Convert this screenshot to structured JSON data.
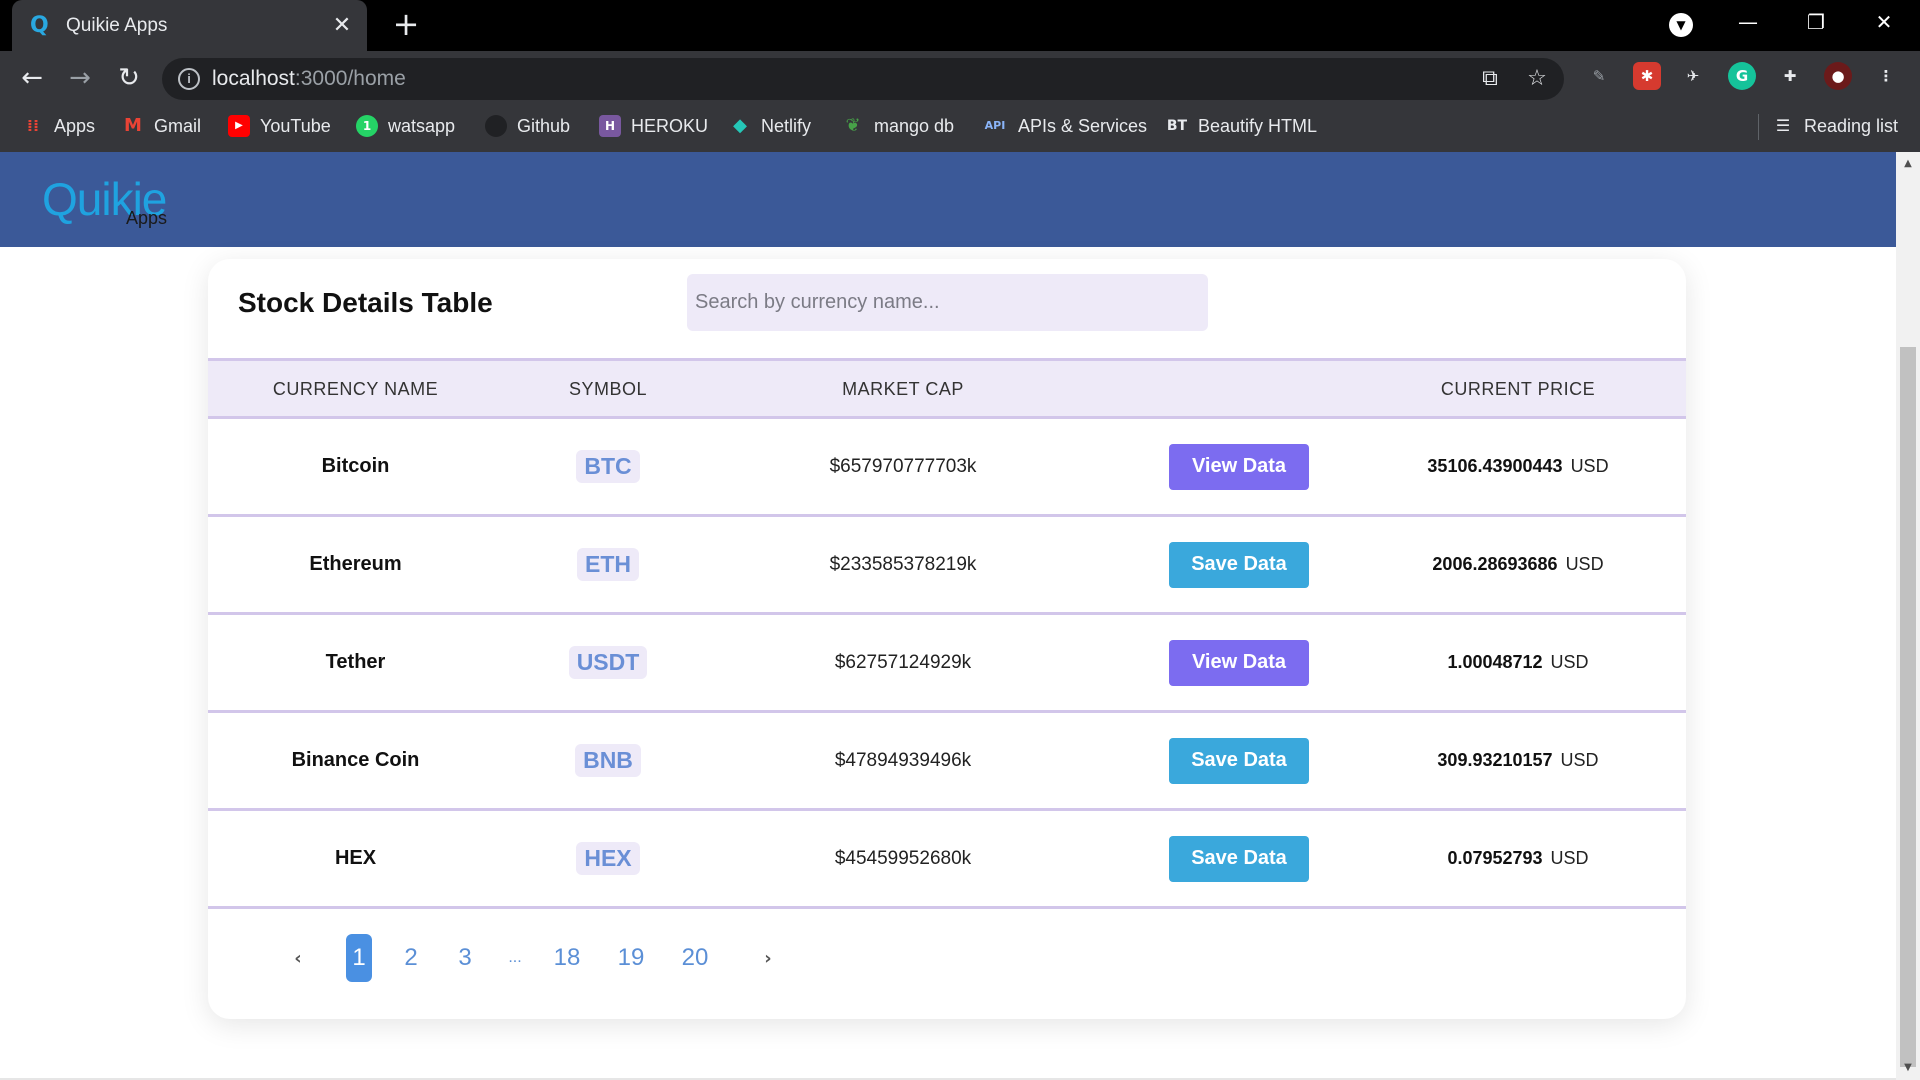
{
  "browser": {
    "tab_title": "Quikie Apps",
    "tab_close": "✕",
    "new_tab": "+",
    "url_host": "localhost",
    "url_rest": ":3000/home",
    "info_icon": "i",
    "window_controls": {
      "minimize": "—",
      "restore": "❐",
      "close": "✕"
    },
    "bookmarks": [
      {
        "label": "Apps",
        "icon": "apps-grid-icon"
      },
      {
        "label": "Gmail",
        "icon": "gmail-icon"
      },
      {
        "label": "YouTube",
        "icon": "youtube-icon"
      },
      {
        "label": "watsapp",
        "icon": "whatsapp-icon"
      },
      {
        "label": "Github",
        "icon": "github-icon"
      },
      {
        "label": "HEROKU",
        "icon": "heroku-icon"
      },
      {
        "label": "Netlify",
        "icon": "netlify-icon"
      },
      {
        "label": "mango db",
        "icon": "mongodb-leaf-icon"
      },
      {
        "label": "APIs & Services",
        "icon": "api-icon"
      },
      {
        "label": "Beautify HTML",
        "icon": "bt-icon"
      }
    ],
    "reading_list": "Reading list"
  },
  "app": {
    "logo_main": "Quikie",
    "logo_sub": "Apps",
    "header_color": "#3b5998"
  },
  "table": {
    "title": "Stock Details Table",
    "search_placeholder": "Search by currency name...",
    "columns": [
      "CURRENCY NAME",
      "SYMBOL",
      "MARKET CAP",
      "",
      "CURRENT PRICE"
    ],
    "rows": [
      {
        "name": "Bitcoin",
        "symbol": "BTC",
        "market_cap": "$657970777703k",
        "action": "View Data",
        "price": "35106.43900443",
        "currency": "USD"
      },
      {
        "name": "Ethereum",
        "symbol": "ETH",
        "market_cap": "$233585378219k",
        "action": "Save Data",
        "price": "2006.28693686",
        "currency": "USD"
      },
      {
        "name": "Tether",
        "symbol": "USDT",
        "market_cap": "$62757124929k",
        "action": "View Data",
        "price": "1.00048712",
        "currency": "USD"
      },
      {
        "name": "Binance Coin",
        "symbol": "BNB",
        "market_cap": "$47894939496k",
        "action": "Save Data",
        "price": "309.93210157",
        "currency": "USD"
      },
      {
        "name": "HEX",
        "symbol": "HEX",
        "market_cap": "$45459952680k",
        "action": "Save Data",
        "price": "0.07952793",
        "currency": "USD"
      }
    ]
  },
  "pagination": {
    "prev": "‹",
    "next": "›",
    "pages": [
      "1",
      "2",
      "3",
      "...",
      "18",
      "19",
      "20"
    ],
    "active": "1"
  },
  "colors": {
    "view_button": "#7c6cf0",
    "save_button": "#3aa8dc",
    "symbol_text": "#6a8fd6",
    "row_divider": "#d2c6ea"
  }
}
